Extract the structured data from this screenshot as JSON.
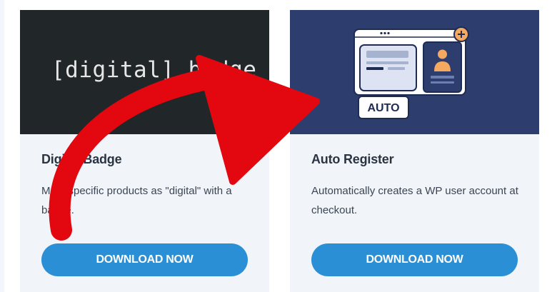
{
  "cards": [
    {
      "thumb_text": "[digital] badge",
      "title": "Digital Badge",
      "description": "Mark specific products as \"digital\" with a badge.",
      "button_label": "DOWNLOAD NOW"
    },
    {
      "thumb_badge": "AUTO",
      "title": "Auto Register",
      "description": "Automatically creates a WP user account at checkout.",
      "button_label": "DOWNLOAD NOW"
    }
  ],
  "colors": {
    "button": "#2b8fd6",
    "arrow": "#e3070f",
    "card_bg": "#f1f5f9",
    "thumb_dark": "#212729",
    "thumb_navy": "#2d3e6e",
    "plus_badge": "#f5a860"
  },
  "icons": [
    "user-avatar-icon",
    "plus-icon",
    "red-arrow-icon"
  ]
}
